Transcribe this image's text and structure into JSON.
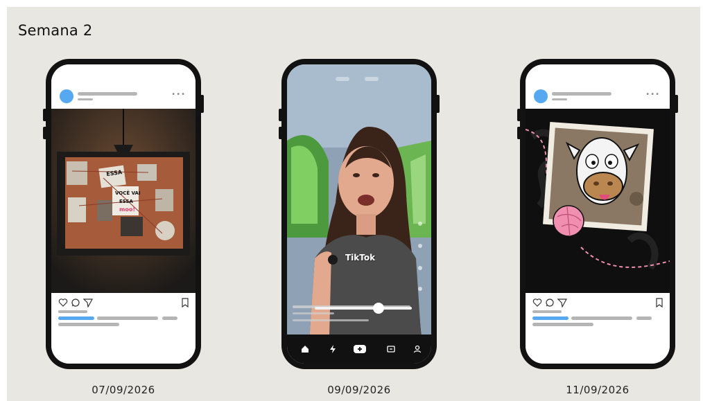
{
  "heading": "Semana 2",
  "posts": [
    {
      "platform": "instagram",
      "date": "07/09/2026",
      "media_text": [
        "ESSA",
        "VOCÊ VAI",
        "ESSA",
        "moo!"
      ]
    },
    {
      "platform": "tiktok",
      "date": "09/09/2026",
      "watermark": "TikTok"
    },
    {
      "platform": "instagram",
      "date": "11/09/2026"
    }
  ],
  "icons": {
    "like": "heart-icon",
    "comment": "comment-icon",
    "share": "send-icon",
    "save": "bookmark-icon",
    "home": "home-icon",
    "friends": "lightning-icon",
    "create": "plus-icon",
    "inbox": "message-icon",
    "profile": "profile-icon"
  },
  "colors": {
    "accent_blue": "#56a9f1",
    "placeholder_gray": "#b5b5b5",
    "phone_frame": "#121212",
    "background": "#e9e7e2",
    "tape_pink": "#f08fb0"
  }
}
